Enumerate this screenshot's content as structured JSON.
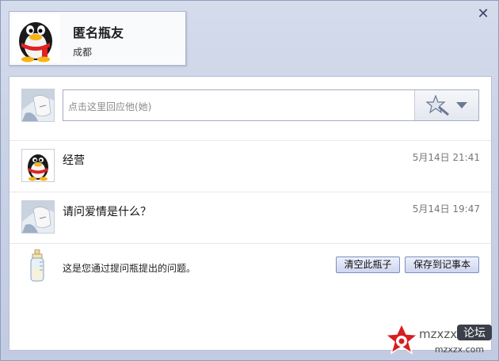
{
  "window": {
    "close_label": "✕"
  },
  "profile": {
    "name": "匿名瓶友",
    "city": "成都",
    "avatar_icon": "qq-penguin-icon"
  },
  "reply": {
    "placeholder": "点击这里回应他(她)",
    "emoji_icon": "magic-wand-icon"
  },
  "messages": [
    {
      "text": "经营",
      "time": "5月14日 21:41",
      "avatar": "qq-penguin-icon"
    },
    {
      "text": "请问爱情是什么？",
      "time": "5月14日 19:47",
      "avatar": "anime-avatar-icon"
    }
  ],
  "footer": {
    "note": "这是您通过提问瓶提出的问题。",
    "clear_label": "清空此瓶子",
    "save_label": "保存到记事本",
    "bottle_icon": "baby-bottle-icon"
  },
  "watermark": {
    "text_top": "论坛",
    "text_bottom": "mzxzx.com"
  },
  "colors": {
    "window_bg": "#c9d2e6",
    "panel_bg": "#ffffff",
    "button_border": "#7d8fc0"
  }
}
